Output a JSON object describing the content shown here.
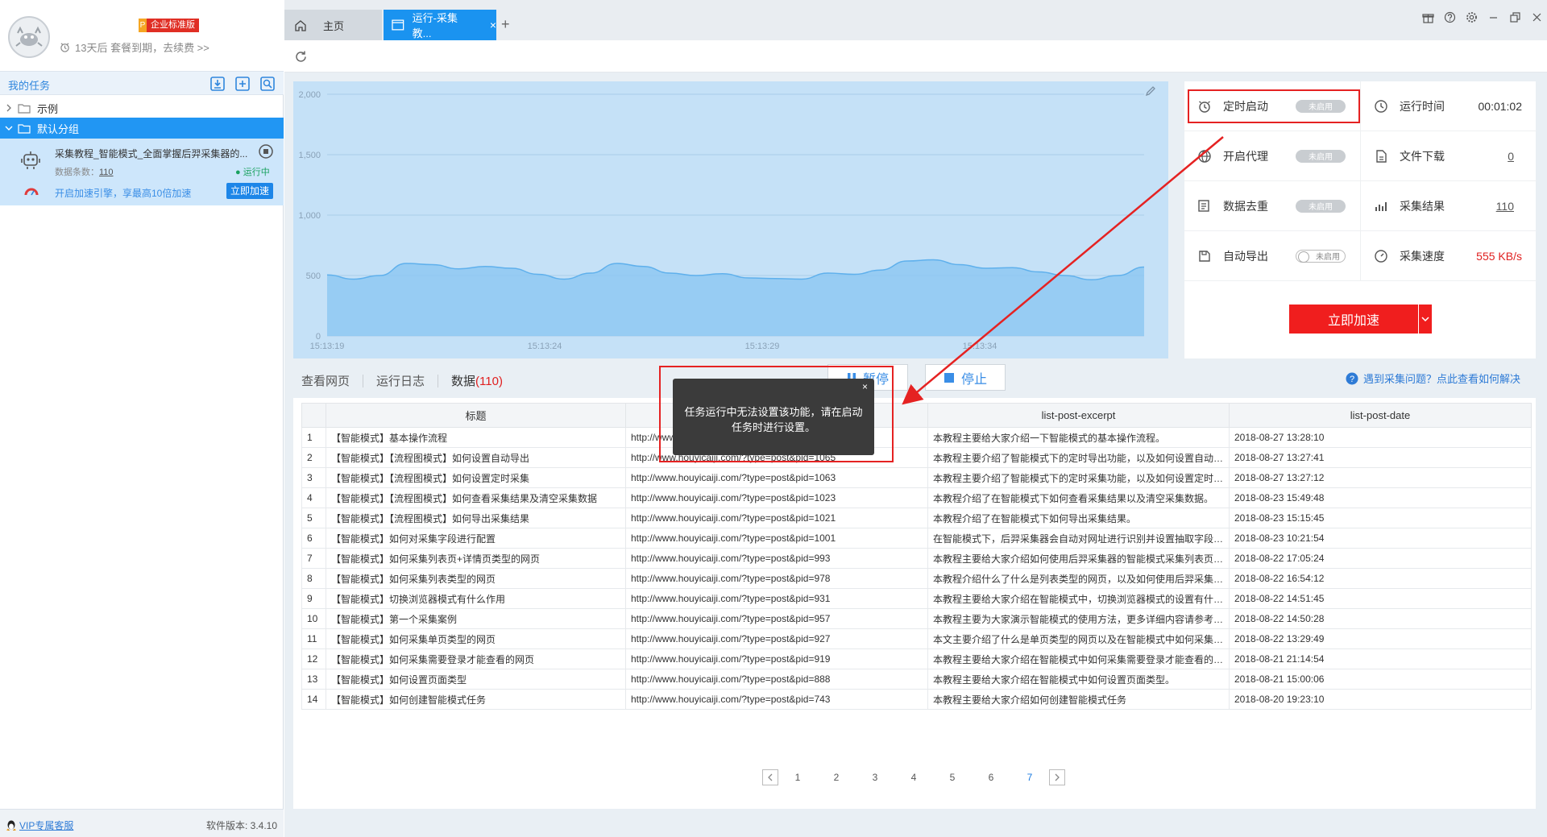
{
  "sidebar": {
    "badge_p": "P",
    "badge_text": "企业标准版",
    "expire_text": "13天后 套餐到期，去续费 >>",
    "my_tasks": "我的任务",
    "tree_example": "示例",
    "tree_default": "默认分组",
    "task": {
      "name": "采集教程_智能模式_全面掌握后羿采集器的...",
      "count_label": "数据条数：",
      "count": "110",
      "status": "运行中",
      "speed_hint": "开启加速引擎，享最高10倍加速",
      "speed_button": "立即加速"
    },
    "vip": "VIP专属客服",
    "version": "软件版本: 3.4.10"
  },
  "tabs": {
    "home": "主页",
    "run": "运行-采集教...",
    "add": "+"
  },
  "chart_data": {
    "type": "area",
    "x": [
      "15:13:19",
      "15:13:24",
      "15:13:29",
      "15:13:34"
    ],
    "ylim": [
      0,
      2000
    ],
    "yticks": [
      "0",
      "500",
      "1,000",
      "1,500",
      "2,000"
    ],
    "y_values": [
      505,
      470,
      500,
      600,
      590,
      555,
      575,
      560,
      510,
      470,
      520,
      600,
      575,
      520,
      500,
      515,
      480,
      475,
      470,
      520,
      510,
      545,
      620,
      630,
      590,
      560,
      565,
      530,
      500,
      465,
      500,
      570
    ],
    "grid": true,
    "color": "#8ec8f2"
  },
  "stats": {
    "timer_start": "定时启动",
    "timer_state": "未启用",
    "run_time_label": "运行时间",
    "run_time": "00:01:02",
    "proxy": "开启代理",
    "proxy_state": "未启用",
    "download_label": "文件下载",
    "download": "0",
    "dedupe": "数据去重",
    "dedupe_state": "未启用",
    "result_label": "采集结果",
    "result": "110",
    "auto_export": "自动导出",
    "auto_export_state": "未启用",
    "speed_label": "采集速度",
    "speed": "555 KB/s",
    "accelerate": "立即加速"
  },
  "subtabs": {
    "view": "查看网页",
    "log": "运行日志",
    "data": "数据",
    "data_count": "(110)"
  },
  "controls": {
    "pause": "暂停",
    "stop": "停止"
  },
  "help": "遇到采集问题？点此查看如何解决",
  "tooltip": {
    "text": "任务运行中无法设置该功能，请在启动任务时进行设置。",
    "close": "×"
  },
  "table": {
    "headers": [
      "",
      "标题",
      "",
      "list-post-excerpt",
      "list-post-date"
    ],
    "rows": [
      [
        "1",
        "【智能模式】基本操作流程",
        "http://www",
        "本教程主要给大家介绍一下智能模式的基本操作流程。",
        "2018-08-27 13:28:10"
      ],
      [
        "2",
        "【智能模式】【流程图模式】如何设置自动导出",
        "http://www.houyicaiji.com/?type=post&pid=1065",
        "本教程主要介绍了智能模式下的定时导出功能，以及如何设置自动导出。",
        "2018-08-27 13:27:41"
      ],
      [
        "3",
        "【智能模式】【流程图模式】如何设置定时采集",
        "http://www.houyicaiji.com/?type=post&pid=1063",
        "本教程主要介绍了智能模式下的定时采集功能，以及如何设置定时采...",
        "2018-08-27 13:27:12"
      ],
      [
        "4",
        "【智能模式】【流程图模式】如何查看采集结果及清空采集数据",
        "http://www.houyicaiji.com/?type=post&pid=1023",
        "本教程介绍了在智能模式下如何查看采集结果以及清空采集数据。",
        "2018-08-23 15:49:48"
      ],
      [
        "5",
        "【智能模式】【流程图模式】如何导出采集结果",
        "http://www.houyicaiji.com/?type=post&pid=1021",
        "本教程介绍了在智能模式下如何导出采集结果。",
        "2018-08-23 15:15:45"
      ],
      [
        "6",
        "【智能模式】如何对采集字段进行配置",
        "http://www.houyicaiji.com/?type=post&pid=1001",
        "在智能模式下，后羿采集器会自动对网址进行识别并设置抽取字段。...",
        "2018-08-23 10:21:54"
      ],
      [
        "7",
        "【智能模式】如何采集列表页+详情页类型的网页",
        "http://www.houyicaiji.com/?type=post&pid=993",
        "本教程主要给大家介绍如何使用后羿采集器的智能模式采集列表页+...",
        "2018-08-22 17:05:24"
      ],
      [
        "8",
        "【智能模式】如何采集列表类型的网页",
        "http://www.houyicaiji.com/?type=post&pid=978",
        "本教程介绍什么了什么是列表类型的网页，以及如何使用后羿采集器...",
        "2018-08-22 16:54:12"
      ],
      [
        "9",
        "【智能模式】切换浏览器模式有什么作用",
        "http://www.houyicaiji.com/?type=post&pid=931",
        "本教程主要给大家介绍在智能模式中，切换浏览器模式的设置有什么...",
        "2018-08-22 14:51:45"
      ],
      [
        "10",
        "【智能模式】第一个采集案例",
        "http://www.houyicaiji.com/?type=post&pid=957",
        "本教程主要为大家演示智能模式的使用方法，更多详细内容请参考智...",
        "2018-08-22 14:50:28"
      ],
      [
        "11",
        "【智能模式】如何采集单页类型的网页",
        "http://www.houyicaiji.com/?type=post&pid=927",
        "本文主要介绍了什么是单页类型的网页以及在智能模式中如何采集单...",
        "2018-08-22 13:29:49"
      ],
      [
        "12",
        "【智能模式】如何采集需要登录才能查看的网页",
        "http://www.houyicaiji.com/?type=post&pid=919",
        "本教程主要给大家介绍在智能模式中如何采集需要登录才能查看的网...",
        "2018-08-21 21:14:54"
      ],
      [
        "13",
        "【智能模式】如何设置页面类型",
        "http://www.houyicaiji.com/?type=post&pid=888",
        "本教程主要给大家介绍在智能模式中如何设置页面类型。",
        "2018-08-21 15:00:06"
      ],
      [
        "14",
        "【智能模式】如何创建智能模式任务",
        "http://www.houyicaiji.com/?type=post&pid=743",
        "本教程主要给大家介绍如何创建智能模式任务",
        "2018-08-20 19:23:10"
      ]
    ]
  },
  "pager": {
    "pages": [
      "1",
      "2",
      "3",
      "4",
      "5",
      "6",
      "7"
    ],
    "current": "7"
  }
}
